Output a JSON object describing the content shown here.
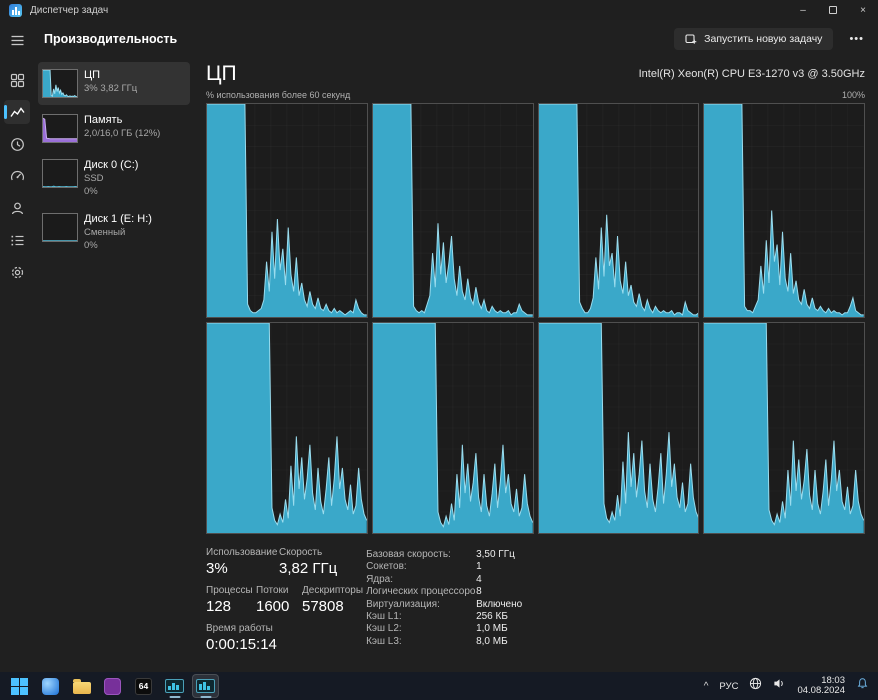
{
  "colors": {
    "cpu_fill": "#3aa8c9",
    "cpu_line": "#9adcee",
    "mem_fill": "#9a6fd8",
    "mem_line": "#c9aef0",
    "disk_fill": "#2e8aa5",
    "disk_line": "#58bcd8",
    "accent": "#4cc2ff"
  },
  "titlebar": {
    "title": "Диспетчер задач",
    "minimize": "–",
    "close": "×"
  },
  "header": {
    "title": "Производительность",
    "run_new_task": "Запустить новую задачу",
    "more": "•••"
  },
  "rail": {
    "icons": [
      "menu-icon",
      "processes-icon",
      "performance-icon",
      "app-history-icon",
      "startup-apps-icon",
      "users-icon",
      "details-icon",
      "services-icon"
    ]
  },
  "perf_list": {
    "items": [
      {
        "name": "ЦП",
        "line1": "3% 3,82 ГГц",
        "line2": "",
        "selected": true
      },
      {
        "name": "Память",
        "line1": "2,0/16,0 ГБ (12%)",
        "line2": ""
      },
      {
        "name": "Диск 0 (C:)",
        "line1": "SSD",
        "line2": "0%"
      },
      {
        "name": "Диск 1 (E: H:)",
        "line1": "Сменный",
        "line2": "0%"
      }
    ]
  },
  "cpu": {
    "title": "ЦП",
    "name": "Intel(R) Xeon(R) CPU E3-1270 v3 @ 3.50GHz",
    "graph_caption": "% использования более 60 секунд",
    "graph_scale": "100%",
    "usage": {
      "label": "Использование",
      "value": "3%"
    },
    "speed": {
      "label": "Скорость",
      "value": "3,82 ГГц"
    },
    "processes": {
      "label": "Процессы",
      "value": "128"
    },
    "threads": {
      "label": "Потоки",
      "value": "1600"
    },
    "handles": {
      "label": "Дескрипторы",
      "value": "57808"
    },
    "uptime": {
      "label": "Время работы",
      "value": "0:00:15:14"
    },
    "specs": [
      {
        "label": "Базовая скорость:",
        "value": "3,50 ГГц"
      },
      {
        "label": "Сокетов:",
        "value": "1"
      },
      {
        "label": "Ядра:",
        "value": "4"
      },
      {
        "label": "Логических процессоров:",
        "value": "8"
      },
      {
        "label": "Виртуализация:",
        "value": "Включено"
      },
      {
        "label": "Кэш L1:",
        "value": "256 КБ"
      },
      {
        "label": "Кэш L2:",
        "value": "1,0 МБ"
      },
      {
        "label": "Кэш L3:",
        "value": "8,0 МБ"
      }
    ]
  },
  "chart_data": {
    "type": "area",
    "title": "% использования более 60 секунд",
    "ylim": [
      0,
      100
    ],
    "x_span_seconds": 60,
    "series": [
      {
        "name": "core-0",
        "values": [
          100,
          100,
          100,
          100,
          100,
          100,
          100,
          100,
          100,
          100,
          100,
          100,
          100,
          100,
          100,
          6,
          3,
          2,
          2,
          3,
          4,
          8,
          26,
          12,
          40,
          18,
          46,
          22,
          32,
          15,
          42,
          20,
          12,
          28,
          10,
          16,
          8,
          5,
          12,
          6,
          4,
          9,
          4,
          3,
          6,
          3,
          2,
          4,
          2,
          3,
          2,
          1,
          2,
          3,
          2,
          8,
          4,
          2,
          1,
          1
        ]
      },
      {
        "name": "core-1",
        "values": [
          100,
          100,
          100,
          100,
          100,
          100,
          100,
          100,
          100,
          100,
          100,
          100,
          100,
          100,
          100,
          5,
          3,
          2,
          3,
          2,
          6,
          10,
          30,
          14,
          44,
          20,
          35,
          16,
          25,
          38,
          18,
          10,
          24,
          12,
          8,
          18,
          9,
          6,
          14,
          7,
          4,
          8,
          3,
          2,
          5,
          3,
          2,
          3,
          2,
          2,
          3,
          1,
          2,
          2,
          6,
          3,
          2,
          1,
          1,
          1
        ]
      },
      {
        "name": "core-2",
        "values": [
          100,
          100,
          100,
          100,
          100,
          100,
          100,
          100,
          100,
          100,
          100,
          100,
          100,
          100,
          100,
          7,
          4,
          2,
          2,
          4,
          9,
          28,
          13,
          42,
          19,
          48,
          24,
          30,
          14,
          38,
          17,
          11,
          26,
          10,
          15,
          7,
          5,
          11,
          5,
          3,
          8,
          4,
          2,
          5,
          3,
          2,
          3,
          2,
          2,
          3,
          1,
          2,
          2,
          1,
          7,
          3,
          2,
          1,
          1,
          2
        ]
      },
      {
        "name": "core-3",
        "values": [
          100,
          100,
          100,
          100,
          100,
          100,
          100,
          100,
          100,
          100,
          100,
          100,
          100,
          100,
          100,
          5,
          3,
          3,
          2,
          5,
          8,
          24,
          11,
          36,
          16,
          50,
          26,
          34,
          15,
          40,
          18,
          12,
          30,
          11,
          17,
          8,
          6,
          13,
          6,
          4,
          9,
          4,
          3,
          5,
          3,
          2,
          4,
          2,
          3,
          2,
          2,
          1,
          2,
          2,
          5,
          9,
          3,
          2,
          1,
          1
        ]
      },
      {
        "name": "core-4",
        "values": [
          100,
          100,
          100,
          100,
          100,
          100,
          100,
          100,
          100,
          100,
          100,
          100,
          100,
          100,
          100,
          100,
          100,
          100,
          100,
          100,
          100,
          100,
          100,
          100,
          12,
          6,
          4,
          9,
          5,
          16,
          7,
          32,
          13,
          46,
          21,
          36,
          16,
          26,
          42,
          19,
          11,
          31,
          15,
          9,
          21,
          36,
          13,
          26,
          46,
          21,
          31,
          16,
          11,
          23,
          9,
          13,
          31,
          16,
          9,
          6
        ]
      },
      {
        "name": "core-5",
        "values": [
          100,
          100,
          100,
          100,
          100,
          100,
          100,
          100,
          100,
          100,
          100,
          100,
          100,
          100,
          100,
          100,
          100,
          100,
          100,
          100,
          100,
          100,
          100,
          100,
          10,
          5,
          3,
          8,
          4,
          14,
          6,
          28,
          12,
          42,
          19,
          33,
          15,
          24,
          38,
          17,
          10,
          28,
          13,
          8,
          19,
          33,
          12,
          24,
          42,
          19,
          28,
          14,
          10,
          21,
          8,
          12,
          28,
          14,
          8,
          5
        ]
      },
      {
        "name": "core-6",
        "values": [
          100,
          100,
          100,
          100,
          100,
          100,
          100,
          100,
          100,
          100,
          100,
          100,
          100,
          100,
          100,
          100,
          100,
          100,
          100,
          100,
          100,
          100,
          100,
          100,
          14,
          7,
          5,
          10,
          6,
          18,
          8,
          34,
          14,
          48,
          22,
          38,
          17,
          28,
          44,
          20,
          12,
          33,
          16,
          10,
          22,
          38,
          14,
          28,
          48,
          22,
          33,
          17,
          12,
          24,
          10,
          14,
          33,
          17,
          10,
          7
        ]
      },
      {
        "name": "core-7",
        "values": [
          100,
          100,
          100,
          100,
          100,
          100,
          100,
          100,
          100,
          100,
          100,
          100,
          100,
          100,
          100,
          100,
          100,
          100,
          100,
          100,
          100,
          100,
          100,
          100,
          11,
          6,
          4,
          9,
          5,
          15,
          7,
          30,
          13,
          44,
          20,
          35,
          16,
          25,
          40,
          18,
          11,
          30,
          14,
          9,
          20,
          35,
          13,
          25,
          44,
          20,
          30,
          15,
          11,
          22,
          9,
          13,
          30,
          15,
          9,
          6
        ]
      }
    ],
    "mini": {
      "cpu": [
        100,
        100,
        100,
        100,
        100,
        100,
        100,
        6,
        3,
        30,
        12,
        45,
        20,
        35,
        15,
        25,
        10,
        15,
        6,
        4,
        8,
        3,
        2,
        4,
        2,
        3,
        2,
        5,
        2,
        1
      ],
      "memory": [
        88,
        84,
        14,
        13,
        12,
        12,
        12,
        12,
        12,
        12,
        12,
        12,
        12,
        12,
        12,
        12,
        12,
        12,
        12,
        12
      ],
      "disk0": [
        2,
        1,
        1,
        2,
        1,
        1,
        3,
        1,
        1,
        2,
        1,
        1,
        1,
        2,
        1,
        1,
        1,
        1,
        2,
        1
      ],
      "disk1": [
        1,
        1,
        1,
        1,
        1,
        1,
        1,
        1,
        1,
        1,
        1,
        1,
        1,
        1,
        1,
        1,
        1,
        1,
        1,
        1
      ]
    }
  },
  "taskbar": {
    "app_64_label": "64",
    "tray": {
      "hidden_icons": "^",
      "language": "РУС",
      "time": "18:03",
      "date": "04.08.2024"
    }
  }
}
